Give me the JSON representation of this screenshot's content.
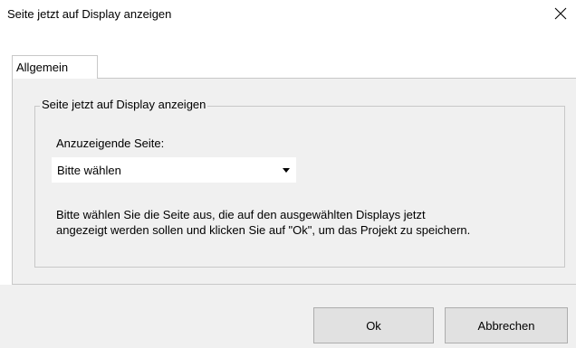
{
  "window": {
    "title": "Seite jetzt auf Display anzeigen",
    "close_icon": "close-icon"
  },
  "tabs": [
    {
      "label": "Allgemein",
      "selected": true
    }
  ],
  "group": {
    "legend": "Seite jetzt auf Display anzeigen",
    "page_label": "Anzuzeigende Seite:",
    "page_select": {
      "value": "Bitte wählen",
      "arrow_icon": "dropdown-arrow-icon"
    },
    "help_text_line1": "Bitte wählen Sie die Seite aus, die auf den ausgewählten Displays jetzt",
    "help_text_line2": "angezeigt werden sollen und klicken Sie auf \"Ok\", um das Projekt zu speichern."
  },
  "buttons": {
    "ok": "Ok",
    "cancel": "Abbrechen"
  },
  "colors": {
    "panel_bg": "#f0f0f0",
    "border": "#c8c8c8",
    "button_bg": "#e1e1e1"
  }
}
